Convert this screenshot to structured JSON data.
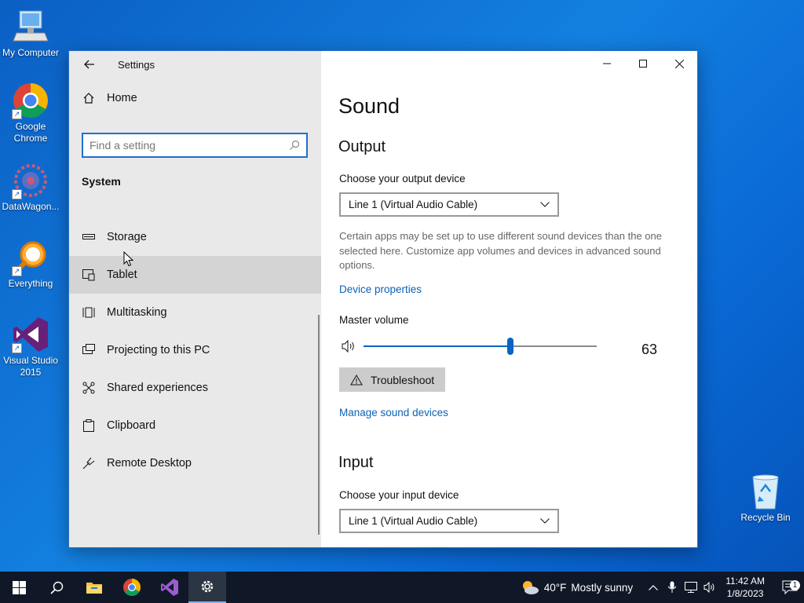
{
  "desktop": {
    "icons": [
      {
        "label": "My Computer"
      },
      {
        "label": "Google Chrome"
      },
      {
        "label": "DataWagon..."
      },
      {
        "label": "Everything"
      },
      {
        "label": "Visual Studio 2015"
      },
      {
        "label": "Recycle Bin"
      }
    ]
  },
  "window": {
    "title": "Settings",
    "home_label": "Home",
    "search_placeholder": "Find a setting",
    "section_title": "System",
    "nav": [
      {
        "label": "Storage",
        "icon": "storage-icon"
      },
      {
        "label": "Tablet",
        "icon": "tablet-icon"
      },
      {
        "label": "Multitasking",
        "icon": "multitasking-icon"
      },
      {
        "label": "Projecting to this PC",
        "icon": "projecting-icon"
      },
      {
        "label": "Shared experiences",
        "icon": "shared-experiences-icon"
      },
      {
        "label": "Clipboard",
        "icon": "clipboard-icon"
      },
      {
        "label": "Remote Desktop",
        "icon": "remote-desktop-icon"
      }
    ]
  },
  "sound": {
    "title": "Sound",
    "output_heading": "Output",
    "output_device_label": "Choose your output device",
    "output_device": "Line 1 (Virtual Audio Cable)",
    "description": "Certain apps may be set up to use different sound devices than the one selected here. Customize app volumes and devices in advanced sound options.",
    "device_properties_link": "Device properties",
    "master_volume_label": "Master volume",
    "master_volume": 63,
    "master_volume_text": "63",
    "troubleshoot_label": "Troubleshoot",
    "manage_devices_link": "Manage sound devices",
    "input_heading": "Input",
    "input_device_label": "Choose your input device",
    "input_device": "Line 1 (Virtual Audio Cable)"
  },
  "taskbar": {
    "weather_temp": "40°F",
    "weather_desc": "Mostly sunny",
    "time": "11:42 AM",
    "date": "1/8/2023",
    "notification_count": "1"
  },
  "colors": {
    "accent": "#0a64c2",
    "link": "#0b63b8",
    "taskbar": "#101827"
  }
}
